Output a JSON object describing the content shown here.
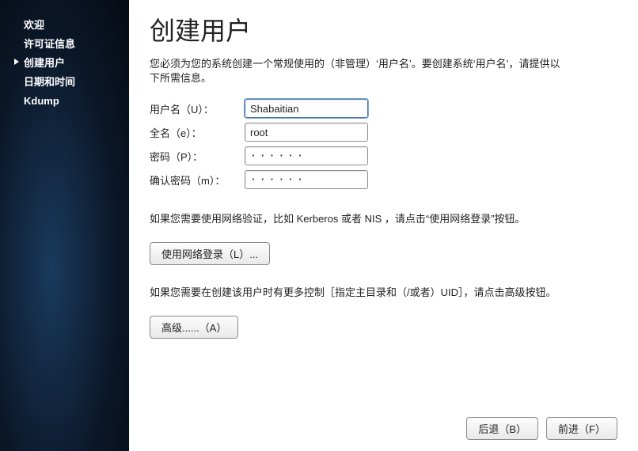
{
  "sidebar": {
    "items": [
      {
        "label": "欢迎"
      },
      {
        "label": "许可证信息"
      },
      {
        "label": "创建用户"
      },
      {
        "label": "日期和时间"
      },
      {
        "label": "Kdump"
      }
    ],
    "activeIndex": 2
  },
  "page": {
    "title": "创建用户",
    "intro": "您必须为您的系统创建一个常规使用的（非管理）‘用户名’。要创建系统‘用户名’，请提供以下所需信息。"
  },
  "form": {
    "username_label": "用户名（U）：",
    "username_value": "Shabaitian",
    "fullname_label": "全名（e）：",
    "fullname_value": "root",
    "password_label": "密码（P）：",
    "password_value": "······",
    "confirm_label": "确认密码（m）：",
    "confirm_value": "······"
  },
  "network": {
    "help": "如果您需要使用网络验证，比如 Kerberos 或者 NIS ，请点击“使用网络登录”按钮。",
    "button": "使用网络登录（L）..."
  },
  "advanced": {
    "help": "如果您需要在创建该用户时有更多控制［指定主目录和（/或者）UID］，请点击高级按钮。",
    "button": "高级......（A）"
  },
  "footer": {
    "back": "后退（B）",
    "forward": "前进（F）"
  }
}
